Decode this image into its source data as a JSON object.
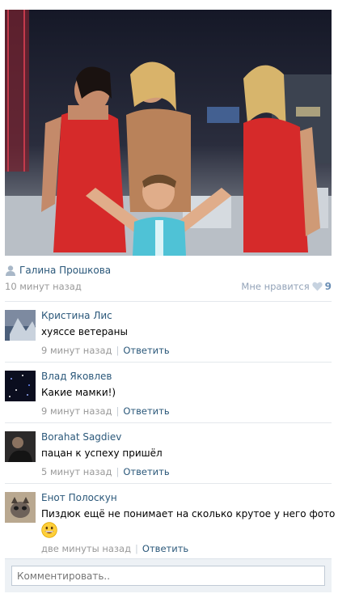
{
  "post": {
    "author": "Галина Прошкова",
    "time": "10 минут назад",
    "like_label": "Мне нравится",
    "like_count": "9"
  },
  "comments": [
    {
      "name": "Кристина Лис",
      "text": "хуяссе ветераны",
      "time": "9 минут назад",
      "reply": "Ответить"
    },
    {
      "name": "Влад Яковлев",
      "text": "Какие мамки!)",
      "time": "9 минут назад",
      "reply": "Ответить"
    },
    {
      "name": "Borahat Sagdiev",
      "text": "пацан к успеху пришёл",
      "time": "5 минут назад",
      "reply": "Ответить"
    },
    {
      "name": "Енот Полоскун",
      "text": "Пиздюк ещё не понимает на сколько крутое у него фото",
      "emoji": "grinning-face-emoji",
      "time": "две минуты назад",
      "reply": "Ответить"
    }
  ],
  "compose": {
    "placeholder": "Комментировать.."
  },
  "colors": {
    "link": "#2b587a",
    "muted": "#999999",
    "like_count": "#6b8fb5",
    "bar_bg": "#edf1f5"
  },
  "icons": {
    "author": "user-icon",
    "like": "heart-icon"
  }
}
